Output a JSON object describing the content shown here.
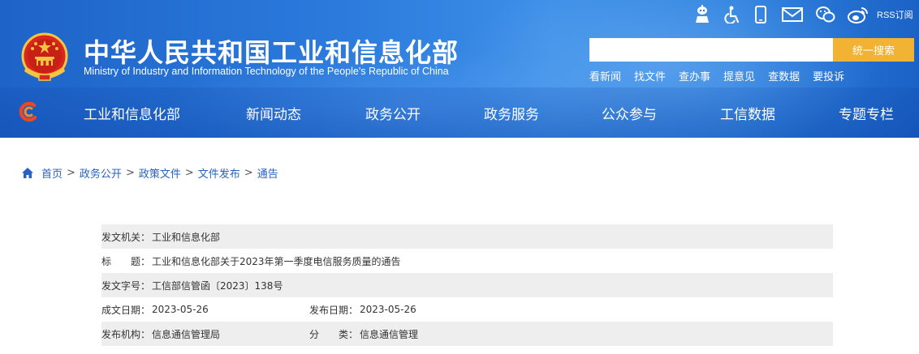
{
  "header": {
    "title": "中华人民共和国工业和信息化部",
    "subtitle": "Ministry of Industry and Information Technology of the People's Republic of China",
    "rss_label": "RSS订阅",
    "utility_icons": [
      "robot-icon",
      "accessibility-icon",
      "mobile-icon",
      "mail-icon",
      "wechat-icon",
      "weibo-icon",
      "rss-icon"
    ]
  },
  "search": {
    "placeholder": "",
    "value": "",
    "button_label": "统一搜索"
  },
  "quick_links": [
    "看新闻",
    "找文件",
    "查办事",
    "提意见",
    "查数据",
    "要投诉"
  ],
  "nav": [
    "工业和信息化部",
    "新闻动态",
    "政务公开",
    "政务服务",
    "公众参与",
    "工信数据",
    "专题专栏"
  ],
  "breadcrumb": [
    "首页",
    "政务公开",
    "政策文件",
    "文件发布",
    "通告"
  ],
  "breadcrumb_separator": ">",
  "document_info": {
    "issuer_label": "发文机关：",
    "issuer": "工业和信息化部",
    "title_label": "标　　题：",
    "title": "工业和信息化部关于2023年第一季度电信服务质量的通告",
    "doc_number_label": "发文字号：",
    "doc_number": "工信部信管函〔2023〕138号",
    "written_date_label": "成文日期：",
    "written_date": "2023-05-26",
    "publish_date_label": "发布日期：",
    "publish_date": "2023-05-26",
    "agency_label": "发布机构：",
    "agency": "信息通信管理局",
    "category_label": "分　　类：",
    "category": "信息通信管理"
  },
  "colors": {
    "header_blue": "#2a79db",
    "search_button": "#f2b233",
    "breadcrumb_link": "#2762c0",
    "row_shade": "#eeeeee"
  }
}
